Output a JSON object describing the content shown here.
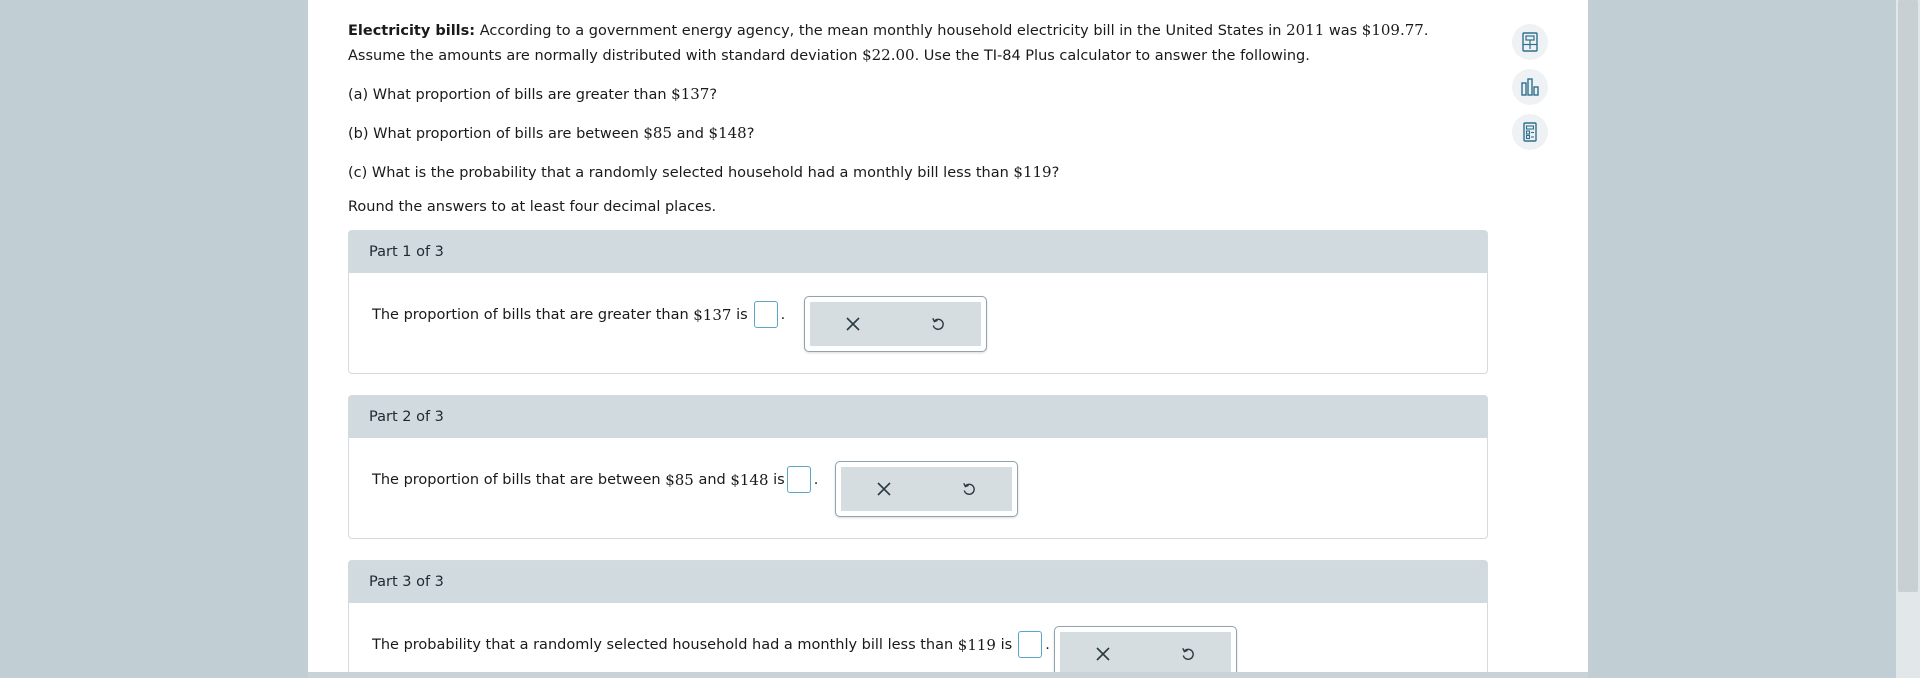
{
  "problem": {
    "title": "Electricity bills:",
    "text_1": "According to a government energy agency, the mean monthly household electricity bill in the United States in",
    "year": "2011",
    "text_2": "was",
    "mean": "$109.77",
    "text_3": ". Assume the",
    "text_4": "amounts are normally distributed with standard deviation",
    "sd": "$22.00",
    "text_5": ". Use the TI-84 Plus calculator to answer the following."
  },
  "questions": {
    "a_prefix": "(a) What proportion of bills are greater than",
    "a_value": "$137",
    "a_suffix": "?",
    "b_prefix": "(b) What proportion of bills are between",
    "b_value1": "$85",
    "b_and": "and",
    "b_value2": "$148",
    "b_suffix": "?",
    "c_prefix": "(c) What is the probability that a randomly selected household had a monthly bill less than",
    "c_value": "$119",
    "c_suffix": "?"
  },
  "round_note": "Round the answers to at least four decimal places.",
  "parts": [
    {
      "header": "Part 1 of 3",
      "prefix": "The proportion of bills that are greater than",
      "value": "$137",
      "suffix": "is",
      "answer": ""
    },
    {
      "header": "Part 2 of 3",
      "prefix": "The proportion of bills that are between",
      "value1": "$85",
      "and": "and",
      "value2": "$148",
      "suffix": "is",
      "answer": ""
    },
    {
      "header": "Part 3 of 3",
      "prefix": "The probability that a randomly selected household had a monthly bill less than",
      "value": "$119",
      "suffix": "is",
      "answer": ""
    }
  ],
  "tools": {
    "clear_icon": "close-icon",
    "undo_icon": "undo-icon"
  },
  "side_tools": [
    "calculator-icon",
    "bar-chart-icon",
    "data-table-icon"
  ],
  "colors": {
    "background": "#c1ced4",
    "header": "#d0dadf",
    "input_border": "#5aa6c4",
    "tool_bg": "#d5dde1",
    "icon": "#2f6f8c"
  }
}
